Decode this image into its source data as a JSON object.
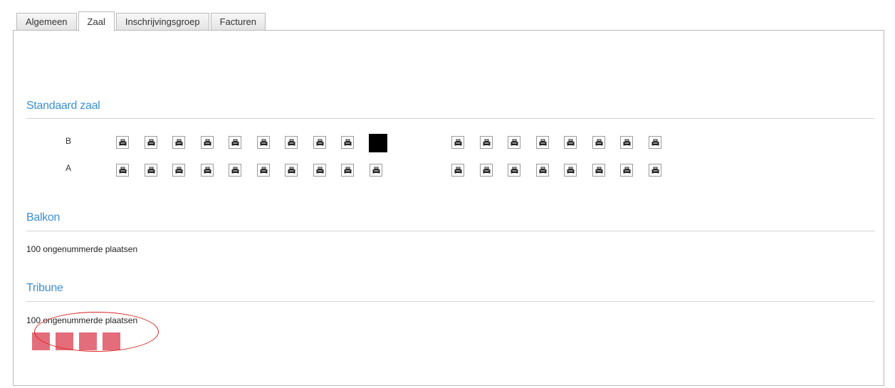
{
  "tabs": [
    {
      "label": "Algemeen",
      "active": false
    },
    {
      "label": "Zaal",
      "active": true
    },
    {
      "label": "Inschrijvingsgroep",
      "active": false
    },
    {
      "label": "Facturen",
      "active": false
    }
  ],
  "sections": {
    "standaard": {
      "title": "Standaard zaal",
      "rows": [
        {
          "label": "B",
          "taken_seat": 10
        },
        {
          "label": "A",
          "taken_seat": null
        }
      ],
      "seats_left_block": 10,
      "seats_right_block": 8
    },
    "balkon": {
      "title": "Balkon",
      "info": "100 ongenummerde plaatsen"
    },
    "tribune": {
      "title": "Tribune",
      "info": "100 ongenummerde plaatsen",
      "selected_blocks": 4
    }
  },
  "colors": {
    "accent": "#3d8fd0",
    "selected": "#e46d7b",
    "highlight": "#dd2222"
  },
  "icons": {
    "seat": "armchair-icon"
  }
}
